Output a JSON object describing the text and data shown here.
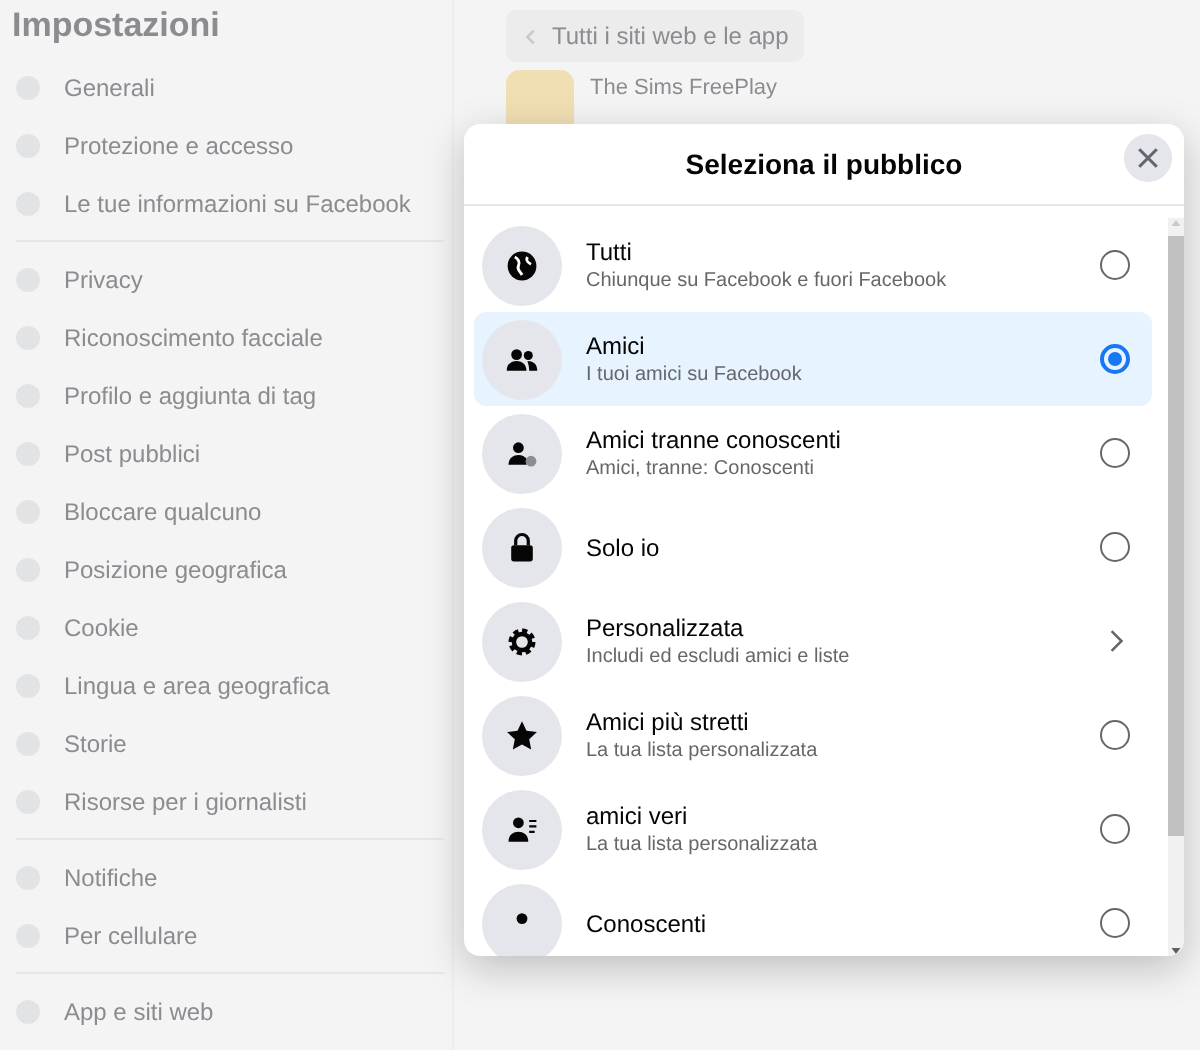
{
  "sidebar": {
    "title": "Impostazioni",
    "groups": [
      {
        "items": [
          "Generali",
          "Protezione e accesso",
          "Le tue informazioni su Facebook"
        ]
      },
      {
        "items": [
          "Privacy",
          "Riconoscimento facciale",
          "Profilo e aggiunta di tag",
          "Post pubblici",
          "Bloccare qualcuno",
          "Posizione geografica",
          "Cookie",
          "Lingua e area geografica",
          "Storie",
          "Risorse per i giornalisti"
        ]
      },
      {
        "items": [
          "Notifiche",
          "Per cellulare"
        ]
      },
      {
        "items": [
          "App e siti web"
        ]
      }
    ]
  },
  "main": {
    "back_button": "Tutti i siti web e le app",
    "app_name": "The Sims FreePlay"
  },
  "dialog": {
    "title": "Seleziona il pubblico",
    "options": [
      {
        "kind": "radio",
        "title": "Tutti",
        "subtitle": "Chiunque su Facebook e fuori Facebook",
        "selected": false
      },
      {
        "kind": "radio",
        "title": "Amici",
        "subtitle": "I tuoi amici su Facebook",
        "selected": true
      },
      {
        "kind": "radio",
        "title": "Amici tranne conoscenti",
        "subtitle": "Amici, tranne: Conoscenti",
        "selected": false
      },
      {
        "kind": "radio",
        "title": "Solo io",
        "selected": false
      },
      {
        "kind": "chevron",
        "title": "Personalizzata",
        "subtitle": "Includi ed escludi amici e liste"
      },
      {
        "kind": "radio",
        "title": "Amici più stretti",
        "subtitle": "La tua lista personalizzata",
        "selected": false
      },
      {
        "kind": "radio",
        "title": "amici veri",
        "subtitle": "La tua lista personalizzata",
        "selected": false
      },
      {
        "kind": "radio",
        "title": "Conoscenti",
        "selected": false
      }
    ]
  }
}
